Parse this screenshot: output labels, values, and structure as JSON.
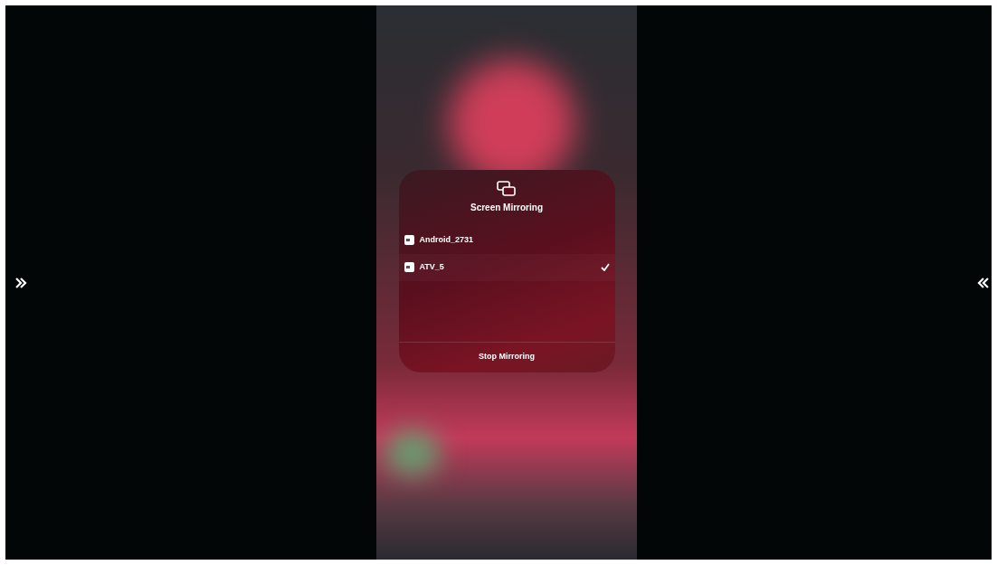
{
  "panel": {
    "title": "Screen Mirroring"
  },
  "devices": [
    {
      "name": "Android_2731",
      "selected": false
    },
    {
      "name": "ATV_5",
      "selected": true
    }
  ],
  "stop_button": {
    "label": "Stop Mirroring"
  }
}
